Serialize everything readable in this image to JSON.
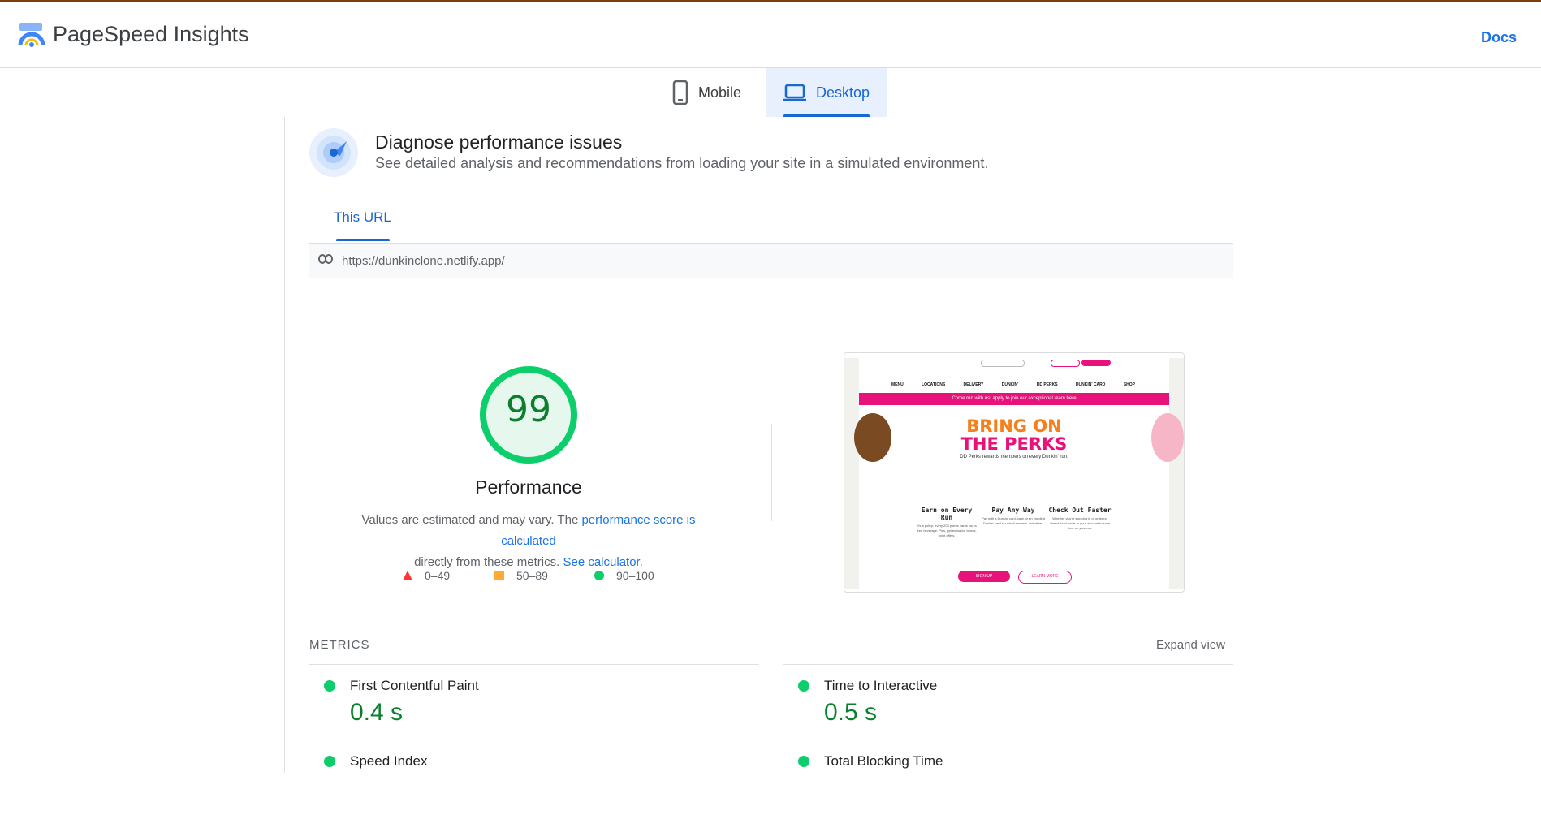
{
  "header": {
    "app_title": "PageSpeed Insights",
    "docs_link": "Docs"
  },
  "device_tabs": [
    {
      "label": "Mobile",
      "icon": "phone-icon",
      "selected": false
    },
    {
      "label": "Desktop",
      "icon": "laptop-icon",
      "selected": true
    }
  ],
  "diagnose": {
    "title": "Diagnose performance issues",
    "description": "See detailed analysis and recommendations from loading your site in a simulated environment."
  },
  "url_tab": {
    "label": "This URL"
  },
  "url": "https://dunkinclone.netlify.app/",
  "performance": {
    "score": "99",
    "score_value": 99,
    "label": "Performance",
    "note_part1": "Values are estimated and may vary. The ",
    "note_link1": "performance score is calculated",
    "note_part2": "directly from these metrics. ",
    "note_link2": "See calculator.",
    "score_color": "#0cce6b"
  },
  "legend": [
    {
      "range": "0–49",
      "shape": "triangle",
      "color": "#ff3333"
    },
    {
      "range": "50–89",
      "shape": "square",
      "color": "#ffaa33"
    },
    {
      "range": "90–100",
      "shape": "circle",
      "color": "#0cce6b"
    }
  ],
  "screenshot_preview": {
    "nav": [
      "MENU",
      "LOCATIONS",
      "DELIVERY",
      "DUNKIN'",
      "DD PERKS",
      "DUNKIN' CARD",
      "SHOP"
    ],
    "banner": "Come run with us: apply to join our exceptional team here",
    "hero_line1": "BRING ON",
    "hero_line2": "THE PERKS",
    "hero_sub": "DD Perks rewards members on every Dunkin' run.",
    "columns": [
      {
        "heading": "Earn on Every Run",
        "text": "It's a policy: every 200 points earns you a free beverage. Plus, get exclusive bonus-point offers."
      },
      {
        "heading": "Pay Any Way",
        "text": "Pay with a Dunkin' card, cash or an enrolled Dunkin' card to unlock rewards and offers."
      },
      {
        "heading": "Check Out Faster",
        "text": "Whether you're skipping in or ordering ahead, load funds to your account to save time on your run."
      }
    ],
    "btn_signup": "SIGN UP",
    "btn_learn": "LEARN MORE",
    "accent_pink": "#e8137a",
    "accent_orange": "#f77f1a"
  },
  "metrics": {
    "title": "METRICS",
    "expand": "Expand view",
    "items": [
      {
        "name": "First Contentful Paint",
        "value": "0.4 s"
      },
      {
        "name": "Time to Interactive",
        "value": "0.5 s"
      },
      {
        "name": "Speed Index",
        "value": ""
      },
      {
        "name": "Total Blocking Time",
        "value": ""
      }
    ]
  }
}
